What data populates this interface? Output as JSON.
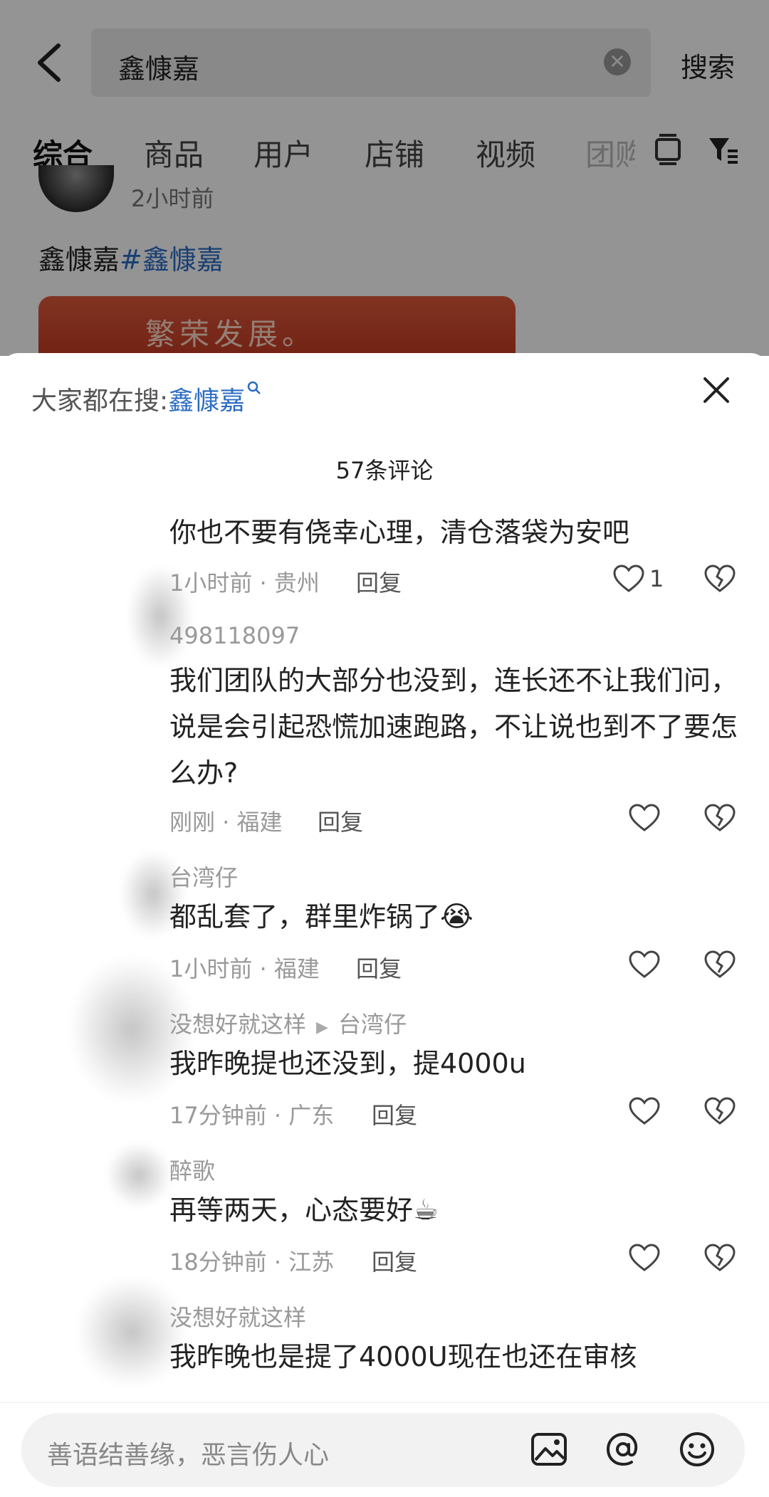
{
  "search": {
    "query": "鑫慷嘉",
    "submit_label": "搜索"
  },
  "tabs": [
    {
      "label": "综合"
    },
    {
      "label": "商品"
    },
    {
      "label": "用户"
    },
    {
      "label": "店铺"
    },
    {
      "label": "视频"
    },
    {
      "label": "团购"
    }
  ],
  "post": {
    "time": "2小时前",
    "title": "鑫慷嘉",
    "hashtag": "#鑫慷嘉",
    "image_text": "繁荣发展。"
  },
  "sheet": {
    "trend_prefix": "大家都在搜:",
    "trend_keyword": "鑫慷嘉",
    "comment_count": "57条评论"
  },
  "comments": [
    {
      "user": "",
      "text": "你也不要有侥幸心理，清仓落袋为安吧",
      "meta": "1小时前 · 贵州",
      "reply": "回复",
      "likes": "1"
    },
    {
      "user": "498118097",
      "text": "我们团队的大部分也没到，连长还不让我们问，说是会引起恐慌加速跑路，不让说也到不了要怎么办?",
      "meta": "刚刚 · 福建",
      "reply": "回复",
      "likes": ""
    },
    {
      "user": "台湾仔",
      "text": "都乱套了，群里炸锅了",
      "emoji": "😭",
      "meta": "1小时前 · 福建",
      "reply": "回复",
      "likes": ""
    },
    {
      "user": "没想好就这样",
      "reply_to": "台湾仔",
      "text": "我昨晚提也还没到，提4000u",
      "meta": "17分钟前 · 广东",
      "reply": "回复",
      "likes": ""
    },
    {
      "user": "醉歌",
      "text": "再等两天，心态要好",
      "emoji": "☕",
      "meta": "18分钟前 · 江苏",
      "reply": "回复",
      "likes": ""
    },
    {
      "user": "没想好就这样",
      "text": "我昨晚也是提了4000U现在也还在审核",
      "meta": "",
      "reply": "",
      "likes": ""
    }
  ],
  "input": {
    "placeholder": "善语结善缘，恶言伤人心"
  },
  "icons": {
    "back": "chevron-left-icon",
    "clear": "clear-circle-icon",
    "list": "list-view-icon",
    "filter": "filter-icon",
    "close": "close-icon",
    "like": "heart-icon",
    "dislike": "broken-heart-icon",
    "image": "image-icon",
    "mention": "at-icon",
    "emoji": "emoji-icon"
  }
}
